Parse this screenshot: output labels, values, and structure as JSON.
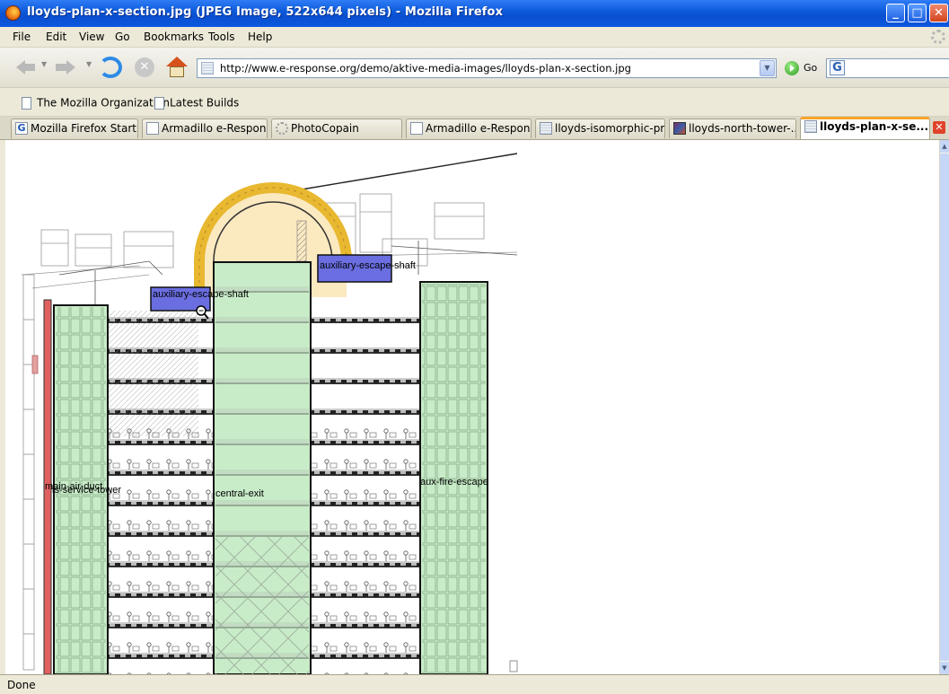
{
  "window": {
    "title": "lloyds-plan-x-section.jpg (JPEG Image, 522x644 pixels) - Mozilla Firefox",
    "buttons": {
      "minimize": "_",
      "maximize": "□",
      "close": "✕"
    }
  },
  "menu": {
    "items": [
      "File",
      "Edit",
      "View",
      "Go",
      "Bookmarks",
      "Tools",
      "Help"
    ]
  },
  "navigation": {
    "url": "http://www.e-response.org/demo/aktive-media-images/lloyds-plan-x-section.jpg",
    "go_label": "Go",
    "search_engine_icon": "G"
  },
  "bookmarks": {
    "items": [
      "The Mozilla Organization",
      "Latest Builds"
    ]
  },
  "tabs": [
    {
      "label": "Mozilla Firefox Start...",
      "icon": "google-icon"
    },
    {
      "label": "Armadillo e-Response",
      "icon": "page-icon"
    },
    {
      "label": "PhotoCopain",
      "icon": "photo-icon"
    },
    {
      "label": "Armadillo e-Response",
      "icon": "page-icon"
    },
    {
      "label": "lloyds-isomorphic-pr...",
      "icon": "image-icon"
    },
    {
      "label": "lloyds-north-tower-...",
      "icon": "lloyds-thumb-icon"
    },
    {
      "label": "lloyds-plan-x-se...",
      "icon": "image-icon",
      "active": true
    }
  ],
  "image_annotations": {
    "auxiliary_escape_shaft_1": "auxiliary-escape-shaft",
    "auxiliary_escape_shaft_2": "auxiliary-escape-shaft",
    "main_air_duct": "main-air-duct",
    "service_tower": "is-service-tower",
    "central_exit": "central-exit",
    "aux_fire_escape": "aux-fire-escape"
  },
  "colors": {
    "highlight_green": "#c8ecc8",
    "highlight_blue": "#6a6ee0",
    "highlight_red": "#e06060",
    "truss_yellow": "#e8b830"
  },
  "status": {
    "text": "Done"
  }
}
